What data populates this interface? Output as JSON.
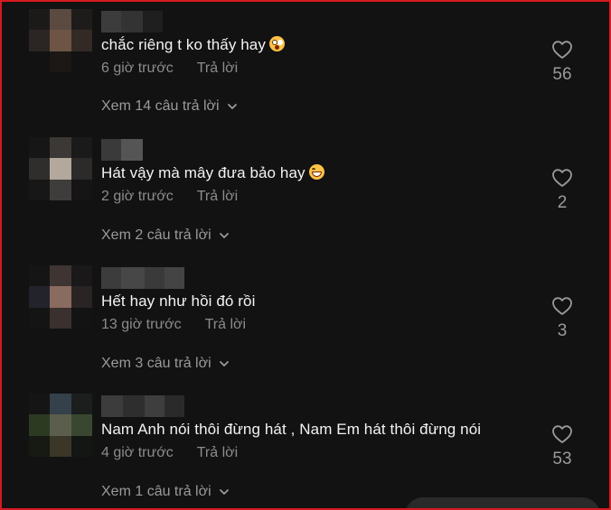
{
  "comments": [
    {
      "text": "chắc riêng t ko thấy hay",
      "emoji": "shocked-face",
      "time": "6 giờ trước",
      "reply_label": "Trả lời",
      "replies_label": "Xem 14 câu trả lời",
      "likes": "56"
    },
    {
      "text": "Hát vậy mà mây đưa bảo hay",
      "emoji": "grinning-face",
      "time": "2 giờ trước",
      "reply_label": "Trả lời",
      "replies_label": "Xem 2 câu trả lời",
      "likes": "2"
    },
    {
      "text": "Hết hay như hồi đó rồi",
      "emoji": "",
      "time": "13 giờ trước",
      "reply_label": "Trả lời",
      "replies_label": "Xem 3 câu trả lời",
      "likes": "3"
    },
    {
      "text": "Nam Anh nói thôi đừng hát , Nam Em hát thôi đừng nói",
      "emoji": "",
      "time": "4 giờ trước",
      "reply_label": "Trả lời",
      "replies_label": "Xem 1 câu trả lời",
      "likes": "53"
    }
  ],
  "colors": {
    "background": "#121212",
    "primary_text": "#f3f3f3",
    "secondary_text": "#8c8c8c",
    "border": "#d71920"
  }
}
